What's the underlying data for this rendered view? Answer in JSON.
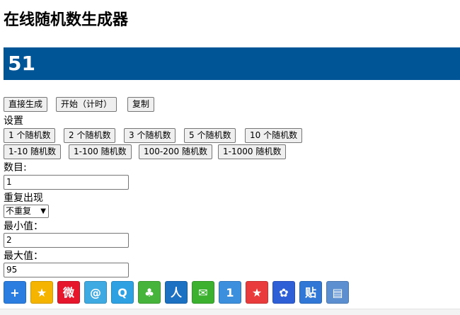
{
  "title": "在线随机数生成器",
  "result": "51",
  "actions": {
    "generate": "直接生成",
    "start_timer": "开始（计时）",
    "copy": "复制"
  },
  "settings_label": "设置",
  "presets_count": [
    "1 个随机数",
    "2 个随机数",
    "3 个随机数",
    "5 个随机数",
    "10 个随机数"
  ],
  "presets_range": [
    "1-10 随机数",
    "1-100 随机数",
    "100-200 随机数",
    "1-1000 随机数"
  ],
  "count": {
    "label": "数目:",
    "value": "1"
  },
  "repeat": {
    "label": "重复出现",
    "selected": "不重复"
  },
  "min": {
    "label": "最小值：",
    "value": "2"
  },
  "max": {
    "label": "最大值：",
    "value": "95"
  },
  "share_icons": [
    {
      "name": "add-share-icon",
      "glyph": "+",
      "color": "#2b7de0"
    },
    {
      "name": "qzone-icon",
      "glyph": "★",
      "color": "#f5b400"
    },
    {
      "name": "weibo-icon",
      "glyph": "微",
      "color": "#e6162d"
    },
    {
      "name": "tencent-weibo-icon",
      "glyph": "@",
      "color": "#3fa9e1"
    },
    {
      "name": "qq-icon",
      "glyph": "Q",
      "color": "#2ea1e3"
    },
    {
      "name": "clover-icon",
      "glyph": "♣",
      "color": "#46b33a"
    },
    {
      "name": "renren-icon",
      "glyph": "人",
      "color": "#1d71c2"
    },
    {
      "name": "wechat-icon",
      "glyph": "✉",
      "color": "#3bb12f"
    },
    {
      "name": "kaixin-icon",
      "glyph": "1",
      "color": "#3c8fdc"
    },
    {
      "name": "favorite-icon",
      "glyph": "★",
      "color": "#e93b3b"
    },
    {
      "name": "baidu-icon",
      "glyph": "✿",
      "color": "#2f5fd7"
    },
    {
      "name": "tieba-icon",
      "glyph": "贴",
      "color": "#3178d6"
    },
    {
      "name": "print-icon",
      "glyph": "▤",
      "color": "#5b8fd0"
    }
  ]
}
